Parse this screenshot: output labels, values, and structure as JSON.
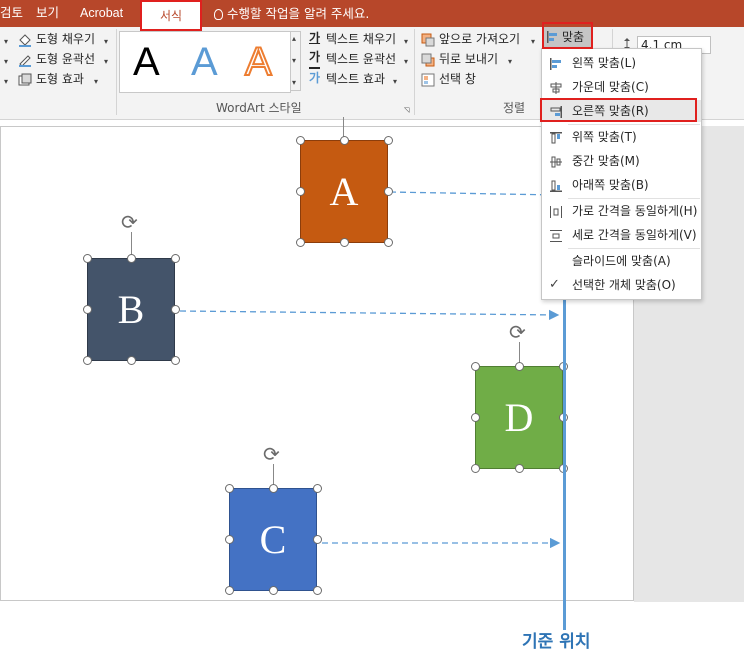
{
  "tabs": {
    "review_partial": "검토",
    "view": "보기",
    "acrobat": "Acrobat",
    "format": "서식",
    "tell_me": "수행할 작업을 알려 주세요."
  },
  "ribbon": {
    "shape_styles": {
      "fill": "도형 채우기",
      "outline": "도형 윤곽선",
      "effects": "도형 효과"
    },
    "wordart": {
      "label": "WordArt 스타일",
      "samples": [
        "A",
        "A",
        "A"
      ],
      "text_fill": "텍스트 채우기",
      "text_outline": "텍스트 윤곽선",
      "text_effects": "텍스트 효과",
      "text_fill_glyph": "가",
      "text_outline_glyph": "가",
      "text_effects_glyph": "가"
    },
    "arrange": {
      "label": "정렬",
      "bring_forward": "앞으로 가져오기",
      "send_backward": "뒤로 보내기",
      "selection_pane": "선택 창",
      "align": "맞춤"
    },
    "size": {
      "height": "4.1 cm"
    }
  },
  "align_menu": {
    "items": [
      {
        "label": "왼쪽 맞춤(L)"
      },
      {
        "label": "가운데 맞춤(C)"
      },
      {
        "label": "오른쪽 맞춤(R)"
      },
      {
        "label": "위쪽 맞춤(T)"
      },
      {
        "label": "중간 맞춤(M)"
      },
      {
        "label": "아래쪽 맞춤(B)"
      },
      {
        "label": "가로 간격을 동일하게(H)"
      },
      {
        "label": "세로 간격을 동일하게(V)"
      },
      {
        "label": "슬라이드에 맞춤(A)"
      },
      {
        "label": "선택한 개체 맞춤(O)"
      }
    ],
    "checked": "선택한 개체 맞춤(O)"
  },
  "shapes": [
    {
      "letter": "A",
      "color": "#c55a11"
    },
    {
      "letter": "B",
      "color": "#44546a"
    },
    {
      "letter": "C",
      "color": "#4472c4"
    },
    {
      "letter": "D",
      "color": "#70ad47"
    }
  ],
  "reference_label": "기준 위치",
  "colors": {
    "tab_bar": "#b7472a",
    "highlight_box": "#e0201e",
    "reference_line": "#5b9bd5",
    "reference_text": "#2e74b5"
  }
}
